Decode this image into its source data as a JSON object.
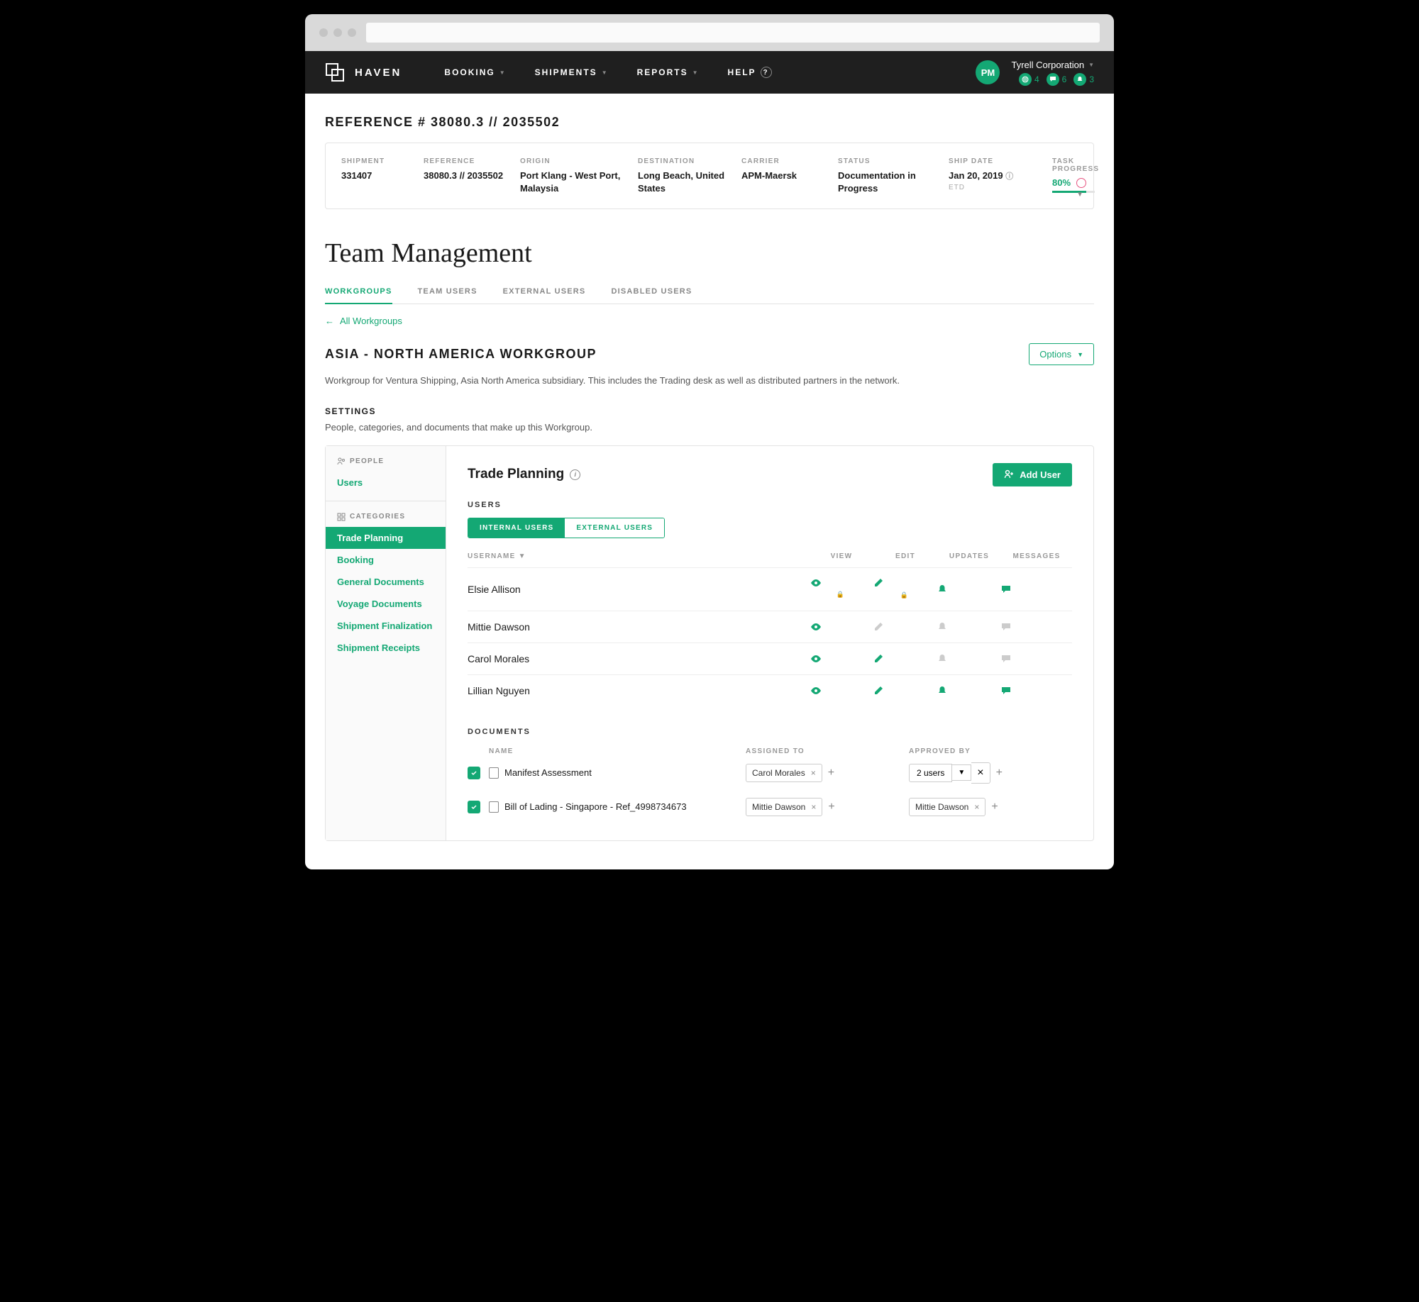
{
  "brand": "HAVEN",
  "nav": {
    "booking": "BOOKING",
    "shipments": "SHIPMENTS",
    "reports": "REPORTS",
    "help": "HELP"
  },
  "user": {
    "initials": "PM",
    "org": "Tyrell Corporation"
  },
  "badges": {
    "b1": "4",
    "b2": "6",
    "b3": "3"
  },
  "ref_title": "REFERENCE # 38080.3 // 2035502",
  "summary": {
    "shipment": {
      "label": "SHIPMENT",
      "value": "331407"
    },
    "reference": {
      "label": "REFERENCE",
      "value": "38080.3 // 2035502"
    },
    "origin": {
      "label": "ORIGIN",
      "value": "Port Klang - West Port, Malaysia"
    },
    "destination": {
      "label": "DESTINATION",
      "value": "Long Beach, United States"
    },
    "carrier": {
      "label": "CARRIER",
      "value": "APM-Maersk"
    },
    "status": {
      "label": "STATUS",
      "value": "Documentation in Progress"
    },
    "ship_date": {
      "label": "SHIP DATE",
      "value": "Jan 20, 2019",
      "sub": "ETD"
    },
    "progress": {
      "label": "TASK PROGRESS",
      "value": "80%"
    }
  },
  "page_title": "Team Management",
  "tabs": {
    "workgroups": "WORKGROUPS",
    "team_users": "TEAM USERS",
    "external_users": "EXTERNAL USERS",
    "disabled_users": "DISABLED USERS"
  },
  "backlink": "All Workgroups",
  "wg_title": "ASIA - NORTH AMERICA WORKGROUP",
  "options": "Options",
  "wg_desc": "Workgroup for Ventura Shipping, Asia North America subsidiary. This includes the Trading desk as well as distributed partners in the network.",
  "settings_label": "SETTINGS",
  "settings_desc": "People, categories, and documents that make up this Workgroup.",
  "sidebar": {
    "people_label": "PEOPLE",
    "users": "Users",
    "categories_label": "CATEGORIES",
    "items": {
      "trade_planning": "Trade Planning",
      "booking": "Booking",
      "general_documents": "General Documents",
      "voyage_documents": "Voyage Documents",
      "shipment_finalization": "Shipment Finalization",
      "shipment_receipts": "Shipment Receipts"
    }
  },
  "main": {
    "title": "Trade Planning",
    "add_user": "Add User",
    "users_label": "USERS",
    "seg": {
      "internal": "INTERNAL USERS",
      "external": "EXTERNAL USERS"
    },
    "cols": {
      "username": "USERNAME",
      "view": "VIEW",
      "edit": "EDIT",
      "updates": "UPDATES",
      "messages": "MESSAGES"
    },
    "rows": {
      "0": {
        "name": "Elsie Allison"
      },
      "1": {
        "name": "Mittie Dawson"
      },
      "2": {
        "name": "Carol Morales"
      },
      "3": {
        "name": "Lillian Nguyen"
      }
    },
    "docs_label": "DOCUMENTS",
    "doc_cols": {
      "name": "NAME",
      "assigned": "ASSIGNED TO",
      "approved": "APPROVED BY"
    },
    "docs": {
      "0": {
        "name": "Manifest Assessment",
        "assigned": "Carol Morales",
        "approved": "2 users"
      },
      "1": {
        "name": "Bill of Lading - Singapore - Ref_4998734673",
        "assigned": "Mittie Dawson",
        "approved": "Mittie Dawson"
      }
    }
  }
}
